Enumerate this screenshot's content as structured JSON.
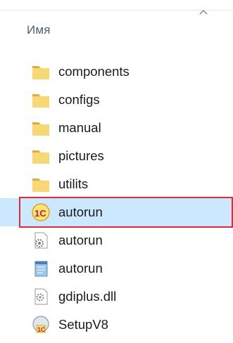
{
  "header": {
    "column_name": "Имя"
  },
  "files": [
    {
      "name": "components",
      "icon": "folder-icon"
    },
    {
      "name": "configs",
      "icon": "folder-icon"
    },
    {
      "name": "manual",
      "icon": "folder-icon"
    },
    {
      "name": "pictures",
      "icon": "folder-icon"
    },
    {
      "name": "utilits",
      "icon": "folder-icon"
    },
    {
      "name": "autorun",
      "icon": "1c-app-icon",
      "selected": true
    },
    {
      "name": "autorun",
      "icon": "settings-file-icon"
    },
    {
      "name": "autorun",
      "icon": "text-file-icon"
    },
    {
      "name": "gdiplus.dll",
      "icon": "dll-file-icon"
    },
    {
      "name": "SetupV8",
      "icon": "1c-setup-icon"
    }
  ],
  "colors": {
    "folder": "#f8d775",
    "selection": "#cce8ff",
    "highlight_border": "#e0283c"
  }
}
